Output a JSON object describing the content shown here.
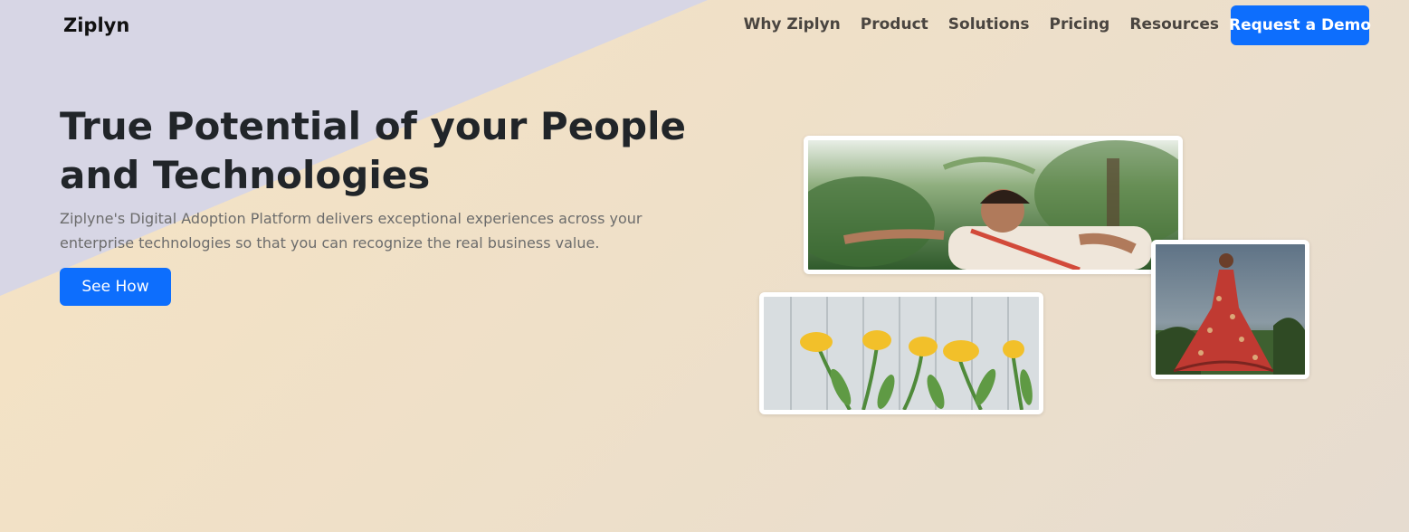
{
  "nav": {
    "brand": "Ziplyn",
    "links": [
      "Why Ziplyn",
      "Product",
      "Solutions",
      "Pricing",
      "Resources"
    ],
    "cta": "Request a Demo"
  },
  "hero": {
    "title": "True Potential of your People and Technologies",
    "subtitle": "Ziplyne's Digital Adoption Platform delivers exceptional experiences across your enterprise technologies so that you can recognize the real business value.",
    "button": "See How"
  },
  "colors": {
    "primary": "#0d6efd",
    "heading": "#212529",
    "muted": "#6c6c6c",
    "triangle": "#d7d6e5"
  }
}
